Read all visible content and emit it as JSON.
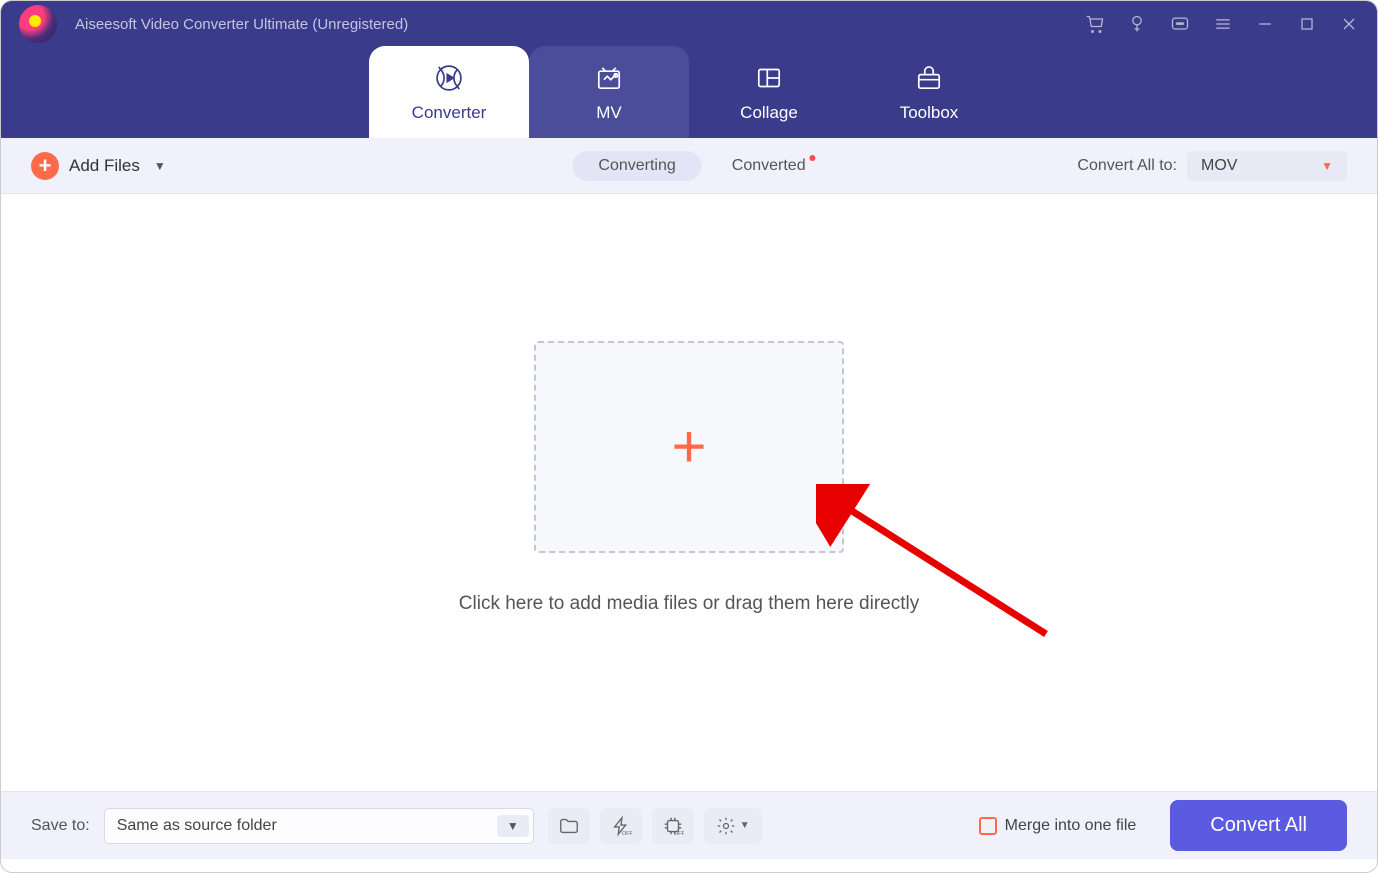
{
  "header": {
    "app_title": "Aiseesoft Video Converter Ultimate (Unregistered)"
  },
  "tabs": {
    "converter": "Converter",
    "mv": "MV",
    "collage": "Collage",
    "toolbox": "Toolbox"
  },
  "toolbar": {
    "add_files": "Add Files",
    "converting": "Converting",
    "converted": "Converted",
    "convert_all_to_label": "Convert All to:",
    "format_selected": "MOV"
  },
  "main": {
    "dropzone_text": "Click here to add media files or drag them here directly"
  },
  "footer": {
    "save_to_label": "Save to:",
    "save_to_value": "Same as source folder",
    "merge_label": "Merge into one file",
    "convert_all_btn": "Convert All"
  }
}
